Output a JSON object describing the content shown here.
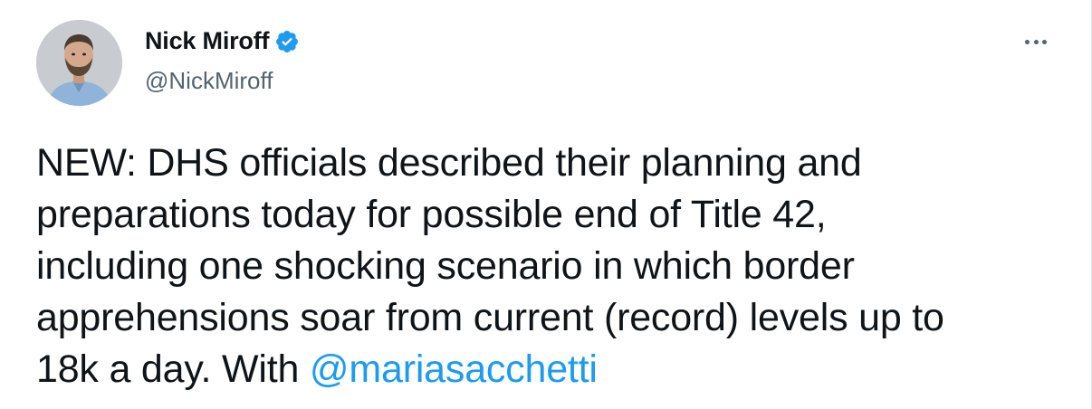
{
  "author": {
    "display_name": "Nick Miroff",
    "handle": "@NickMiroff",
    "verified": true
  },
  "tweet": {
    "lines": [
      "NEW: DHS officials described their planning and",
      "preparations today for possible end of Title 42,",
      "including one shocking scenario in which border",
      "apprehensions soar from current (record) levels up to"
    ],
    "last_line_prefix": "18k a day. With ",
    "mention": "@mariasacchetti"
  },
  "icons": {
    "verified": "verified-badge-icon",
    "more": "more-options-icon"
  },
  "colors": {
    "accent": "#1d9bf0",
    "text": "#0f1419",
    "secondary": "#536471"
  }
}
